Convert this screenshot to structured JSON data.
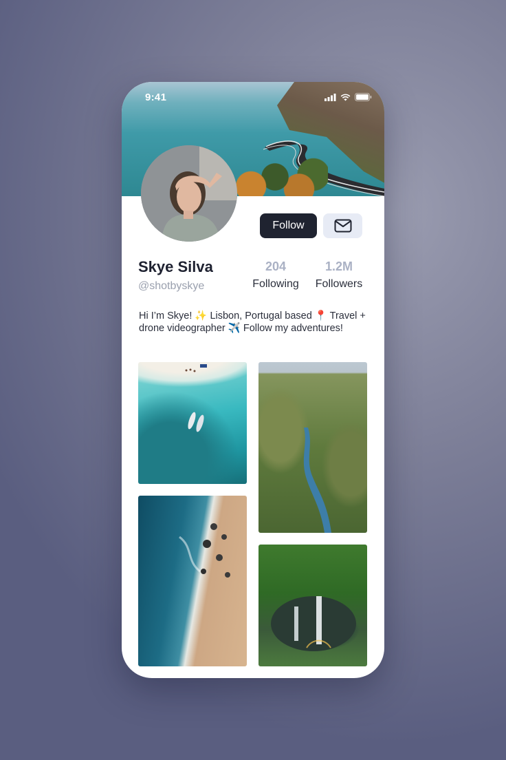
{
  "status_bar": {
    "time": "9:41",
    "icons": [
      "signal-icon",
      "wifi-icon",
      "battery-icon"
    ]
  },
  "profile": {
    "name": "Skye Silva",
    "handle": "@shotbyskye",
    "follow_label": "Follow",
    "stats": {
      "following_count": "204",
      "following_label": "Following",
      "followers_count": "1.2M",
      "followers_label": "Followers"
    },
    "bio": "Hi I’m Skye! ✨ Lisbon, Portugal based 📍 Travel + drone videographer ✈️ Follow my adventures!"
  },
  "gallery": {
    "items": [
      "beach-aerial-photo",
      "canyon-river-photo",
      "coastline-aerial-photo",
      "waterfall-photo"
    ]
  },
  "colors": {
    "follow_button": "#1f2330",
    "message_button": "#e7ebf5",
    "stat_number": "#aab1c4",
    "handle_text": "#9aa0ae"
  }
}
